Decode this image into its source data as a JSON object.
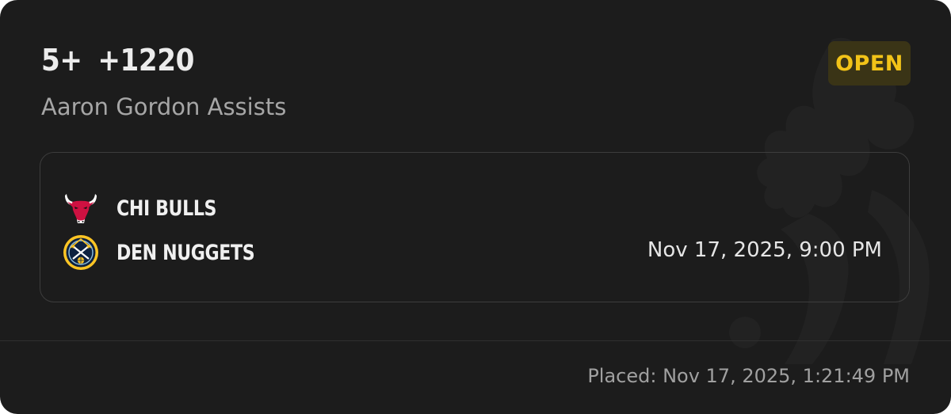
{
  "bet": {
    "line": "5+",
    "odds": "+1220",
    "market": "Aaron Gordon Assists",
    "status": "OPEN"
  },
  "game": {
    "away_team": {
      "name": "CHI BULLS",
      "logo": "chicago-bulls-logo"
    },
    "home_team": {
      "name": "DEN NUGGETS",
      "logo": "denver-nuggets-logo"
    },
    "start_time": "Nov 17, 2025, 9:00 PM"
  },
  "footer": {
    "placed": "Placed: Nov 17, 2025, 1:21:49 PM"
  },
  "colors": {
    "card_background": "#1c1c1c",
    "status_text": "#f2c318",
    "status_background": "#3a3416",
    "bulls_red": "#ce1141",
    "nuggets_gold": "#fec524",
    "nuggets_navy": "#0e2240"
  }
}
